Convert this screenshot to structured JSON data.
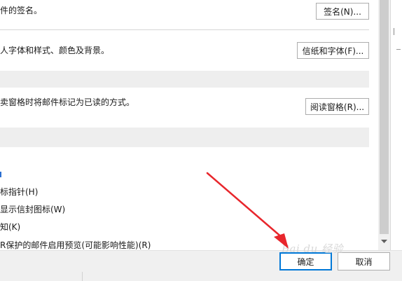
{
  "signature": {
    "desc": "件的签名。",
    "button": "签名(N)..."
  },
  "stationery": {
    "desc": "人字体和样式、颜色及背景。",
    "button": "信纸和字体(F)..."
  },
  "reading": {
    "desc": "卖窗格时将邮件标记为已读的方式。",
    "button": "阅读窗格(R)..."
  },
  "options": [
    "标指针(H)",
    "显示信封图标(W)",
    "知(K)",
    "R保护的邮件启用预览(可能影响性能)(R)"
  ],
  "footer": {
    "ok_label": "确定",
    "cancel_label": "取消"
  },
  "watermark": "Bai du 经验",
  "colors": {
    "arrow": "#e8262c",
    "accent": "#2b6fd1"
  }
}
